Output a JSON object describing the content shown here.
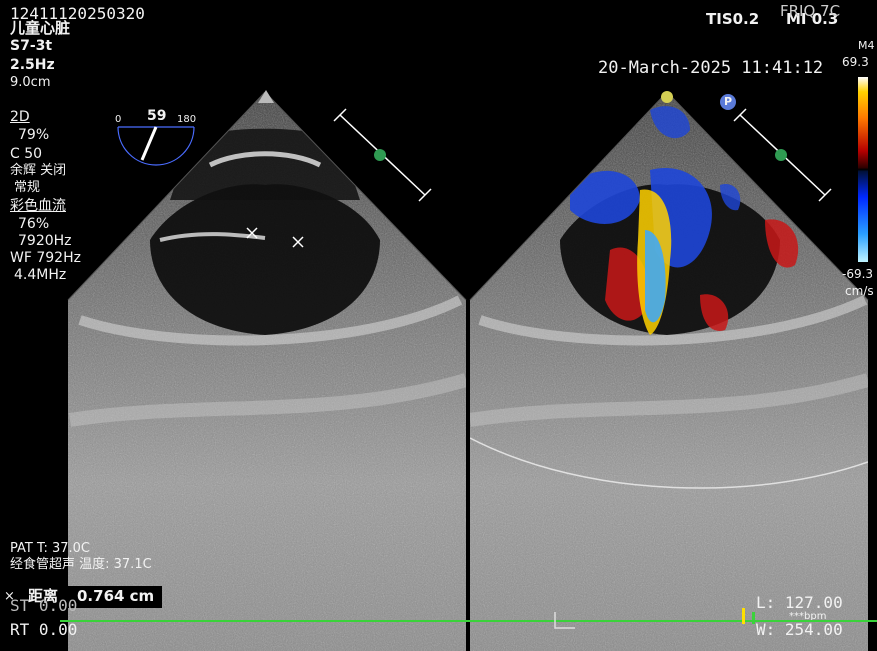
{
  "header": {
    "patient_id": "12411120250320",
    "dept": "儿童心脏",
    "probe": "S7-3t",
    "freq": "2.5Hz",
    "depth": "9.0cm",
    "tis": "TIS0.2",
    "mi": "MI 0.3",
    "frq_temp": "FRIQ 7C",
    "datetime": "20-March-2025 11:41:12",
    "m4": "M4"
  },
  "left_params": {
    "mode_2d": "2D",
    "gain_2d": "79%",
    "compress": "C 50",
    "persist": "余辉 关闭",
    "preset": "常规",
    "color_flow": "彩色血流",
    "color_gain": "76%",
    "prf": "7920Hz",
    "wall_filter": "WF 792Hz",
    "color_freq": "4.4MHz"
  },
  "angle_indicator": {
    "min": "0",
    "value": "59",
    "max": "180"
  },
  "color_scale": {
    "top": "69.3",
    "bottom": "-69.3",
    "unit": "cm/s"
  },
  "bottom_info": {
    "pat_temp": "PAT T: 37.0C",
    "probe_temp": "经食管超声 温度: 37.1C",
    "distance_label": "距离",
    "distance_value": "0.764 cm",
    "st": "ST 0.00",
    "rt": "RT 0.00",
    "l_value": "L: 127.00",
    "w_value": "W: 254.00",
    "bpm": "***bpm",
    "p_marker": "P"
  },
  "colors": {
    "ecg": "#3ad23a",
    "marker_green": "#2f9b52",
    "flow_red": "#c81818",
    "flow_blue": "#1e46d8",
    "flow_yellow": "#ffe000"
  }
}
